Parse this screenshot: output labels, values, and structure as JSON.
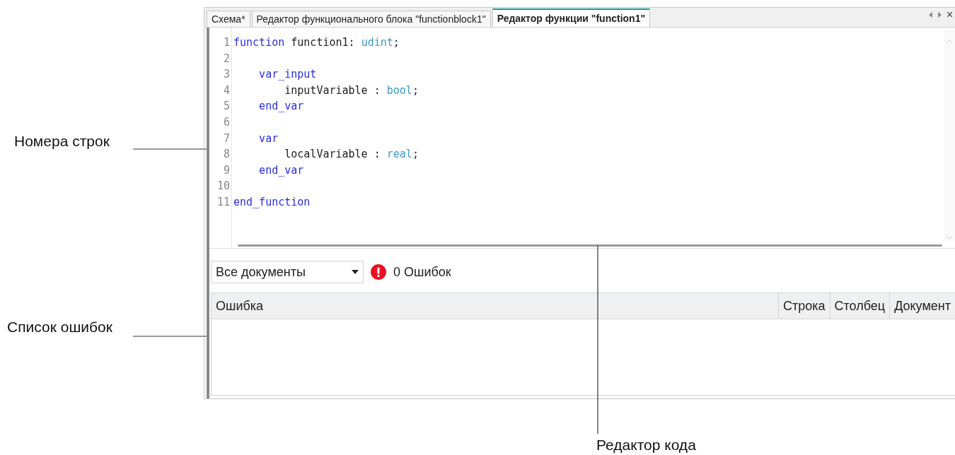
{
  "tabs": [
    {
      "label": "Схема*",
      "selected": false
    },
    {
      "label": "Редактор функционального блока \"functionblock1\"",
      "selected": false
    },
    {
      "label": "Редактор функции \"function1\"",
      "selected": true
    }
  ],
  "editor": {
    "lines": [
      {
        "number": "1",
        "tokens": [
          {
            "kind": "keyword",
            "text": "function"
          },
          {
            "kind": "plain",
            "text": " function1: "
          },
          {
            "kind": "type",
            "text": "udint"
          },
          {
            "kind": "plain",
            "text": ";"
          }
        ]
      },
      {
        "number": "2"
      },
      {
        "number": "3",
        "tokens": [
          {
            "kind": "keyword",
            "text": "    var_input"
          }
        ]
      },
      {
        "number": "4",
        "tokens": [
          {
            "kind": "plain",
            "text": "        inputVariable : "
          },
          {
            "kind": "type",
            "text": "bool"
          },
          {
            "kind": "plain",
            "text": ";"
          }
        ]
      },
      {
        "number": "5",
        "tokens": [
          {
            "kind": "keyword",
            "text": "    end_var"
          }
        ]
      },
      {
        "number": "6"
      },
      {
        "number": "7",
        "tokens": [
          {
            "kind": "keyword",
            "text": "    var"
          }
        ]
      },
      {
        "number": "8",
        "tokens": [
          {
            "kind": "plain",
            "text": "        localVariable : "
          },
          {
            "kind": "type",
            "text": "real"
          },
          {
            "kind": "plain",
            "text": ";"
          }
        ]
      },
      {
        "number": "9",
        "tokens": [
          {
            "kind": "keyword",
            "text": "    end_var"
          }
        ]
      },
      {
        "number": "10"
      },
      {
        "number": "11",
        "tokens": [
          {
            "kind": "keyword",
            "text": "end_function"
          }
        ]
      }
    ]
  },
  "errors": {
    "filter": "Все документы",
    "count": "0 Ошибок",
    "columns": [
      "Ошибка",
      "Строка",
      "Столбец",
      "Документ"
    ]
  },
  "callouts": [
    {
      "kind": "left",
      "text": "Номера строк"
    },
    {
      "kind": "left",
      "text": "Список ошибок"
    },
    {
      "kind": "bottom",
      "text": "Редактор кода"
    }
  ]
}
